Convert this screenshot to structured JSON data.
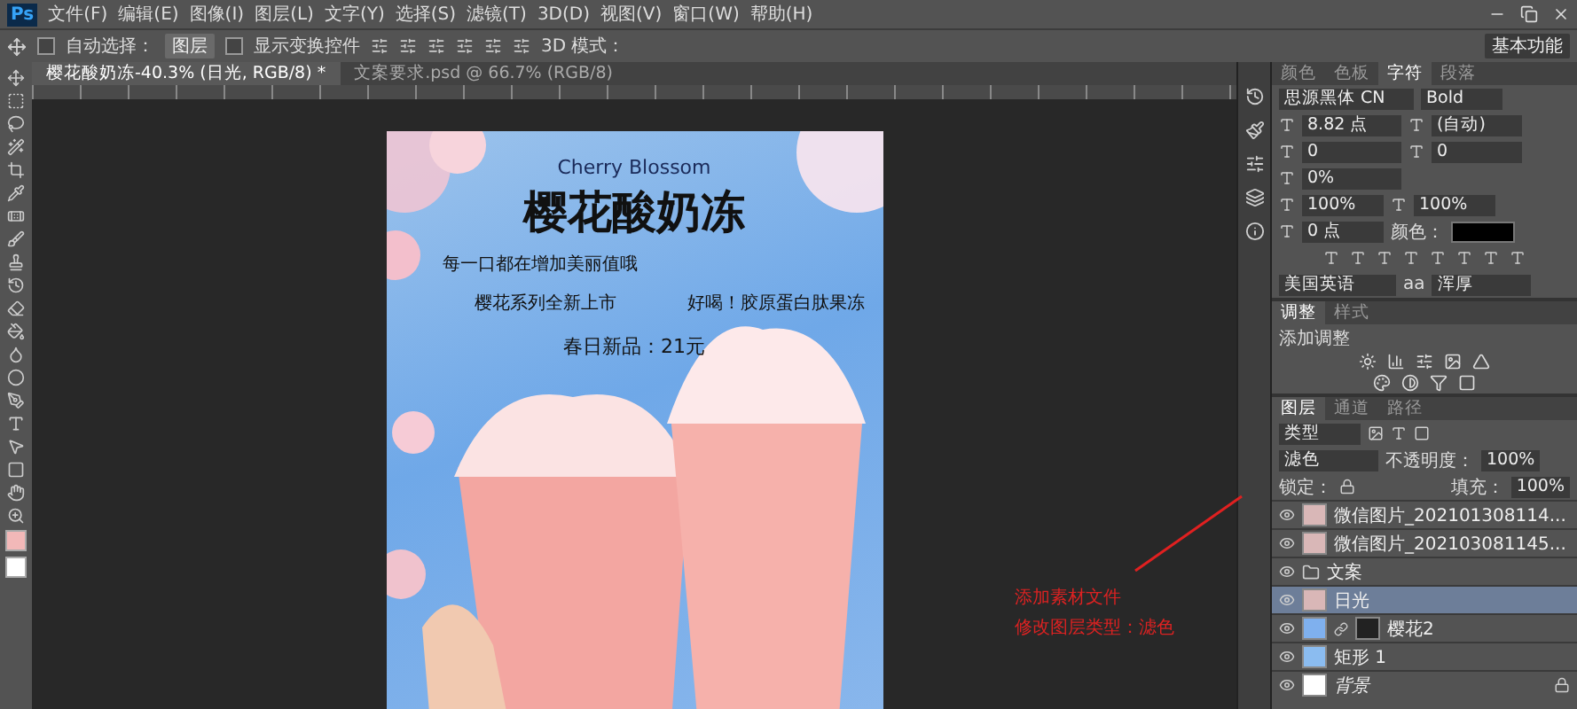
{
  "menu_bar": {
    "logo": "Ps",
    "items": [
      "文件(F)",
      "编辑(E)",
      "图像(I)",
      "图层(L)",
      "文字(Y)",
      "选择(S)",
      "滤镜(T)",
      "3D(D)",
      "视图(V)",
      "窗口(W)",
      "帮助(H)"
    ]
  },
  "options_bar": {
    "auto_select": {
      "label": "自动选择：",
      "checked": false
    },
    "target": "图层",
    "show_transform": {
      "label": "显示变换控件",
      "checked": false
    },
    "mode_3d": "3D 模式：",
    "workspace": "基本功能"
  },
  "document_tabs": [
    {
      "label": "樱花酸奶冻-40.3% (日光, RGB/8) *",
      "selected": true
    },
    {
      "label": "文案要求.psd @ 66.7% (RGB/8)",
      "selected": false
    }
  ],
  "poster": {
    "subtitle": "Cherry Blossom",
    "title": "樱花酸奶冻",
    "tagline": "每一口都在增加美丽值哦",
    "series": "樱花系列全新上市",
    "note": "好喝！胶原蛋白肽果冻",
    "price": "春日新品：21元"
  },
  "annotation": {
    "lines": [
      "添加素材文件",
      "修改图层类型：滤色"
    ]
  },
  "character_panel": {
    "tabs": [
      {
        "label": "颜色",
        "selected": false
      },
      {
        "label": "色板",
        "selected": false
      },
      {
        "label": "字符",
        "selected": true
      },
      {
        "label": "段落",
        "selected": false
      }
    ],
    "font_family": "思源黑体 CN",
    "font_style": "Bold",
    "size": "8.82 点",
    "leading": "(自动)",
    "kerning": "0",
    "tracking": "0",
    "baseline_scale": "0%",
    "vertical_scale": "100%",
    "horizontal_scale": "100%",
    "baseline_shift": "0 点",
    "color_label": "颜色：",
    "language": "美国英语",
    "aa_label": "aa",
    "anti_alias": "浑厚"
  },
  "adjustments_panel": {
    "tabs": [
      {
        "label": "调整",
        "selected": true
      },
      {
        "label": "样式",
        "selected": false
      }
    ],
    "title": "添加调整"
  },
  "layers_panel": {
    "tabs": [
      {
        "label": "图层",
        "selected": true
      },
      {
        "label": "通道",
        "selected": false
      },
      {
        "label": "路径",
        "selected": false
      }
    ],
    "filter": "类型",
    "blend_mode": "滤色",
    "opacity_label": "不透明度：",
    "opacity": "100%",
    "lock_label": "锁定：",
    "fill_label": "填充：",
    "fill": "100%",
    "layers": [
      {
        "name": "微信图片_202101308114...",
        "kind": "image",
        "selected": false,
        "visible": true
      },
      {
        "name": "微信图片_202103081145...",
        "kind": "image",
        "selected": false,
        "visible": true
      },
      {
        "name": "文案",
        "kind": "group",
        "selected": false,
        "visible": true
      },
      {
        "name": "日光",
        "kind": "image",
        "selected": true,
        "visible": true
      },
      {
        "name": "樱花2",
        "kind": "masked",
        "selected": false,
        "visible": true
      },
      {
        "name": "矩形 1",
        "kind": "shape",
        "selected": false,
        "visible": true
      },
      {
        "name": "背景",
        "kind": "background",
        "selected": false,
        "visible": true
      }
    ]
  }
}
